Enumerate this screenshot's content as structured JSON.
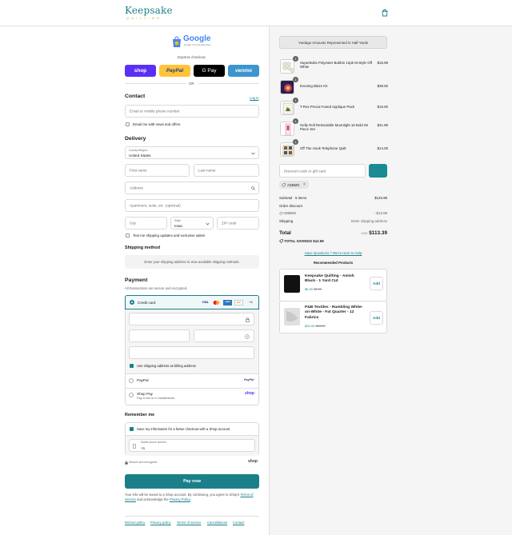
{
  "header": {
    "brand": "Keepsake",
    "brand_sub": "QUILTING",
    "bag_icon": "shopping-bag-icon"
  },
  "express": {
    "google_label": "Google",
    "google_tagline": "Google Your Favorite Store",
    "label": "Express checkout",
    "buttons": [
      {
        "name": "shop",
        "label": "shop",
        "bg": "#5a31f4",
        "fg": "#ffffff"
      },
      {
        "name": "paypal",
        "label": "PayPal",
        "bg": "#ffc439",
        "fg": "#253b80"
      },
      {
        "name": "gpay",
        "label": "G Pay",
        "bg": "#000000",
        "fg": "#ffffff"
      },
      {
        "name": "venmo",
        "label": "venmo",
        "bg": "#3d95ce",
        "fg": "#ffffff"
      }
    ],
    "or": "OR"
  },
  "contact": {
    "title": "Contact",
    "login": "Log in",
    "email_placeholder": "Email or mobile phone number",
    "news_label": "Email me with news and offers"
  },
  "delivery": {
    "title": "Delivery",
    "country_label": "Country/Region",
    "country_value": "United States",
    "first_name": "First name",
    "last_name": "Last name",
    "address": "Address",
    "apartment": "Apartment, suite, etc. (optional)",
    "city": "City",
    "state_label": "State",
    "state_value": "Iowa",
    "zip": "ZIP code",
    "sms_label": "Text me shipping updates and exclusive sales!"
  },
  "shipping_method": {
    "title": "Shipping method",
    "note": "Enter your shipping address to view available shipping methods."
  },
  "payment": {
    "title": "Payment",
    "subtitle": "All transactions are secure and encrypted.",
    "credit_card": "Credit card",
    "more_cards": "+4",
    "card_brands": [
      "VISA",
      "MC",
      "AMEX",
      "DISC"
    ],
    "billing_label": "Use shipping address as billing address",
    "paypal": "PayPal",
    "paypal_logo": "PayPal",
    "shoppay": "Shop Pay",
    "shoppay_sub": "Pay in full or in installments",
    "shoppay_logo": "shop"
  },
  "remember": {
    "title": "Remember me",
    "save_label": "Save my information for a faster checkout with a Shop account",
    "phone_label": "Mobile phone number",
    "phone_value": "+1",
    "secure": "Secure and encrypted",
    "shop_logo": "shop"
  },
  "pay_now": "Pay now",
  "legal": {
    "text1": "Your info will be saved to a Shop account. By continuing, you agree to Shop's",
    "terms": "Terms of Service",
    "and": "and acknowledge the",
    "privacy": "Privacy Policy",
    "end": "."
  },
  "footer_links": [
    "Refund policy",
    "Privacy policy",
    "Terms of service",
    "Cancellations",
    "Contact"
  ],
  "summary": {
    "banner": "Yardage Amounts Represented in Half-Yards",
    "items": [
      {
        "qty": "1",
        "name": "SuperBobs Polyester Bobbin 12pk M-Style Off White",
        "price": "$16.99"
      },
      {
        "qty": "1",
        "name": "Evening Blaze Kit",
        "price": "$38.00"
      },
      {
        "qty": "1",
        "name": "T-Rex Precut Fused Applique Pack",
        "price": "$15.00"
      },
      {
        "qty": "1",
        "name": "Gelly Roll Retractable Moonlight 10 Bold 25 Piece Set",
        "price": "$41.99"
      },
      {
        "qty": "1",
        "name": "Off The Hook Telephone Quilt",
        "price": "$14.00"
      }
    ],
    "discount_placeholder": "Discount code or gift card",
    "code": "ADBMO",
    "subtotal_label": "Subtotal · 5 items",
    "subtotal": "$125.98",
    "order_discount": "Order discount",
    "discount_code": "ADBMO",
    "discount_value": "- $12.59",
    "shipping_label": "Shipping",
    "shipping_value": "Enter shipping address",
    "total_label": "Total",
    "currency": "USD",
    "total": "$113.39",
    "savings_label": "TOTAL SAVINGS",
    "savings": "$12.59",
    "help": "Have Questions ? We're Here to Help",
    "recommended": "Recommended Products",
    "recs": [
      {
        "name": "Keepsake Quilting - Amish Black - 1 Yard Cut",
        "price": "$6.99",
        "was": "$9.99",
        "add": "Add"
      },
      {
        "name": "P&B Textiles - Rambling White-on-White - Fat Quarter - 12 Fabrics",
        "price": "$32.00",
        "was": "$34.99",
        "add": "Add"
      }
    ]
  },
  "colors": {
    "accent": "#1b7f8a",
    "apply_button": "#1b8a92"
  }
}
